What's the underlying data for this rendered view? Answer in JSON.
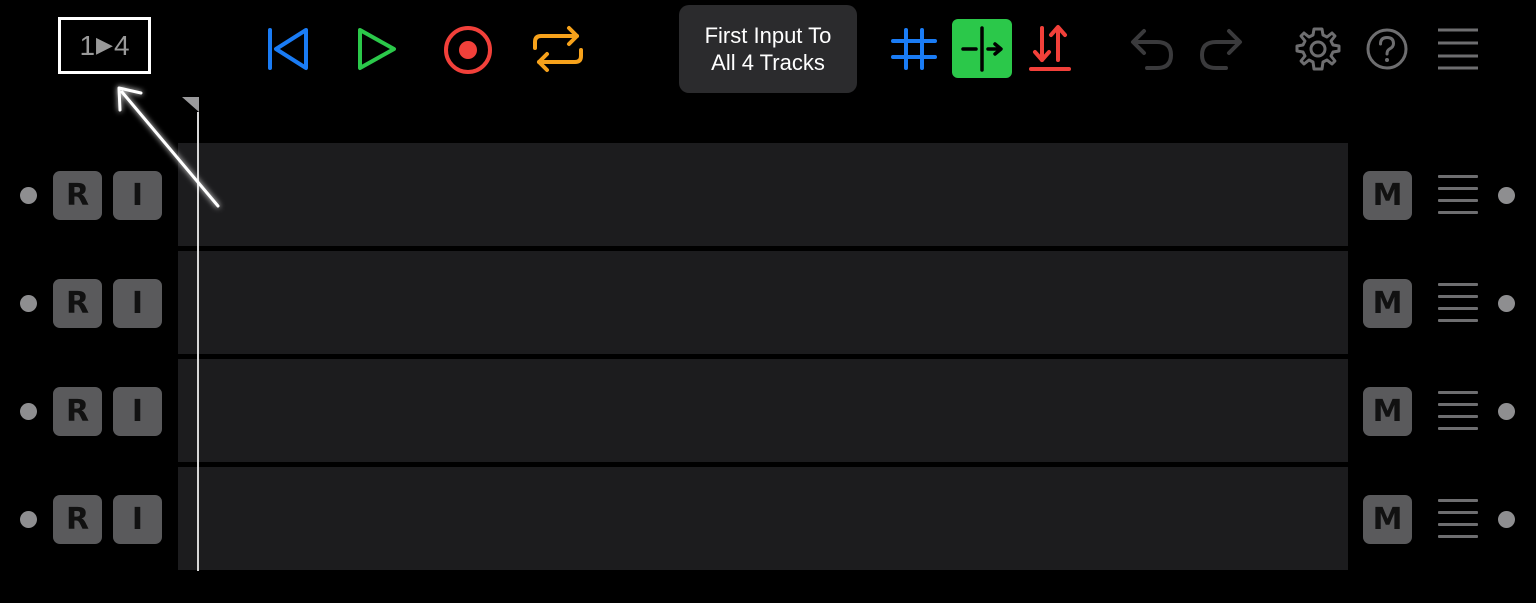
{
  "toolbar": {
    "routing_button": {
      "left": "1",
      "arrow": "▶",
      "right": "4"
    },
    "tooltip": {
      "line1": "First Input To",
      "line2": "All 4 Tracks"
    },
    "icons": {
      "rewind": "skip-to-start-icon",
      "play": "play-icon",
      "record": "record-icon",
      "loop": "loop-icon",
      "grid": "grid-icon",
      "split": "split-icon",
      "sort": "sort-icon",
      "undo": "undo-icon",
      "redo": "redo-icon",
      "settings": "gear-icon",
      "help": "help-icon",
      "menu": "hamburger-menu-icon"
    },
    "colors": {
      "rewind": "#1a7cf5",
      "play": "#2bc84a",
      "record": "#f2403a",
      "loop": "#f7a21b",
      "grid": "#1a7cf5",
      "split_bg": "#2bc84a",
      "sort": "#f2403a",
      "disabled": "#3a3a3c",
      "inactive": "#6e6e70"
    }
  },
  "tracks": [
    {
      "record_label": "R",
      "input_label": "I",
      "mute_label": "M"
    },
    {
      "record_label": "R",
      "input_label": "I",
      "mute_label": "M"
    },
    {
      "record_label": "R",
      "input_label": "I",
      "mute_label": "M"
    },
    {
      "record_label": "R",
      "input_label": "I",
      "mute_label": "M"
    }
  ]
}
